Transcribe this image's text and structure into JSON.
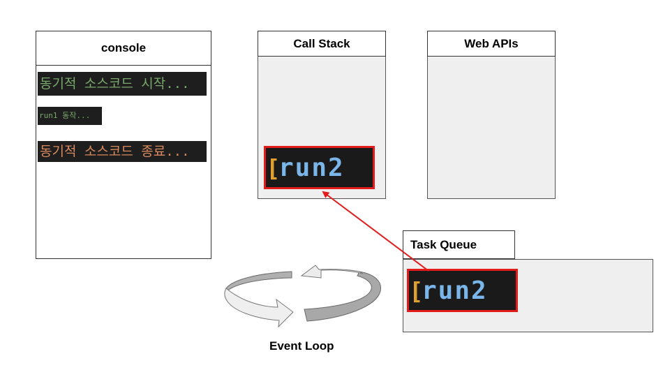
{
  "console": {
    "title": "console",
    "lines": [
      {
        "text": "동기적 소스코드 시작...",
        "color": "#79a96b"
      },
      {
        "text": "run1 동작...",
        "color": "#79a96b"
      },
      {
        "text": "동기적 소스코드 종료...",
        "color": "#d98a5e"
      }
    ]
  },
  "call_stack": {
    "title": "Call Stack",
    "item": "run2"
  },
  "web_apis": {
    "title": "Web APIs"
  },
  "task_queue": {
    "title": "Task Queue",
    "item": "run2"
  },
  "event_loop": {
    "label": "Event Loop"
  },
  "colors": {
    "highlight": "#e21b1b",
    "code_bg": "#1a1a1a",
    "code_text": "#7ab6ea",
    "panel_bg": "#efefef"
  }
}
